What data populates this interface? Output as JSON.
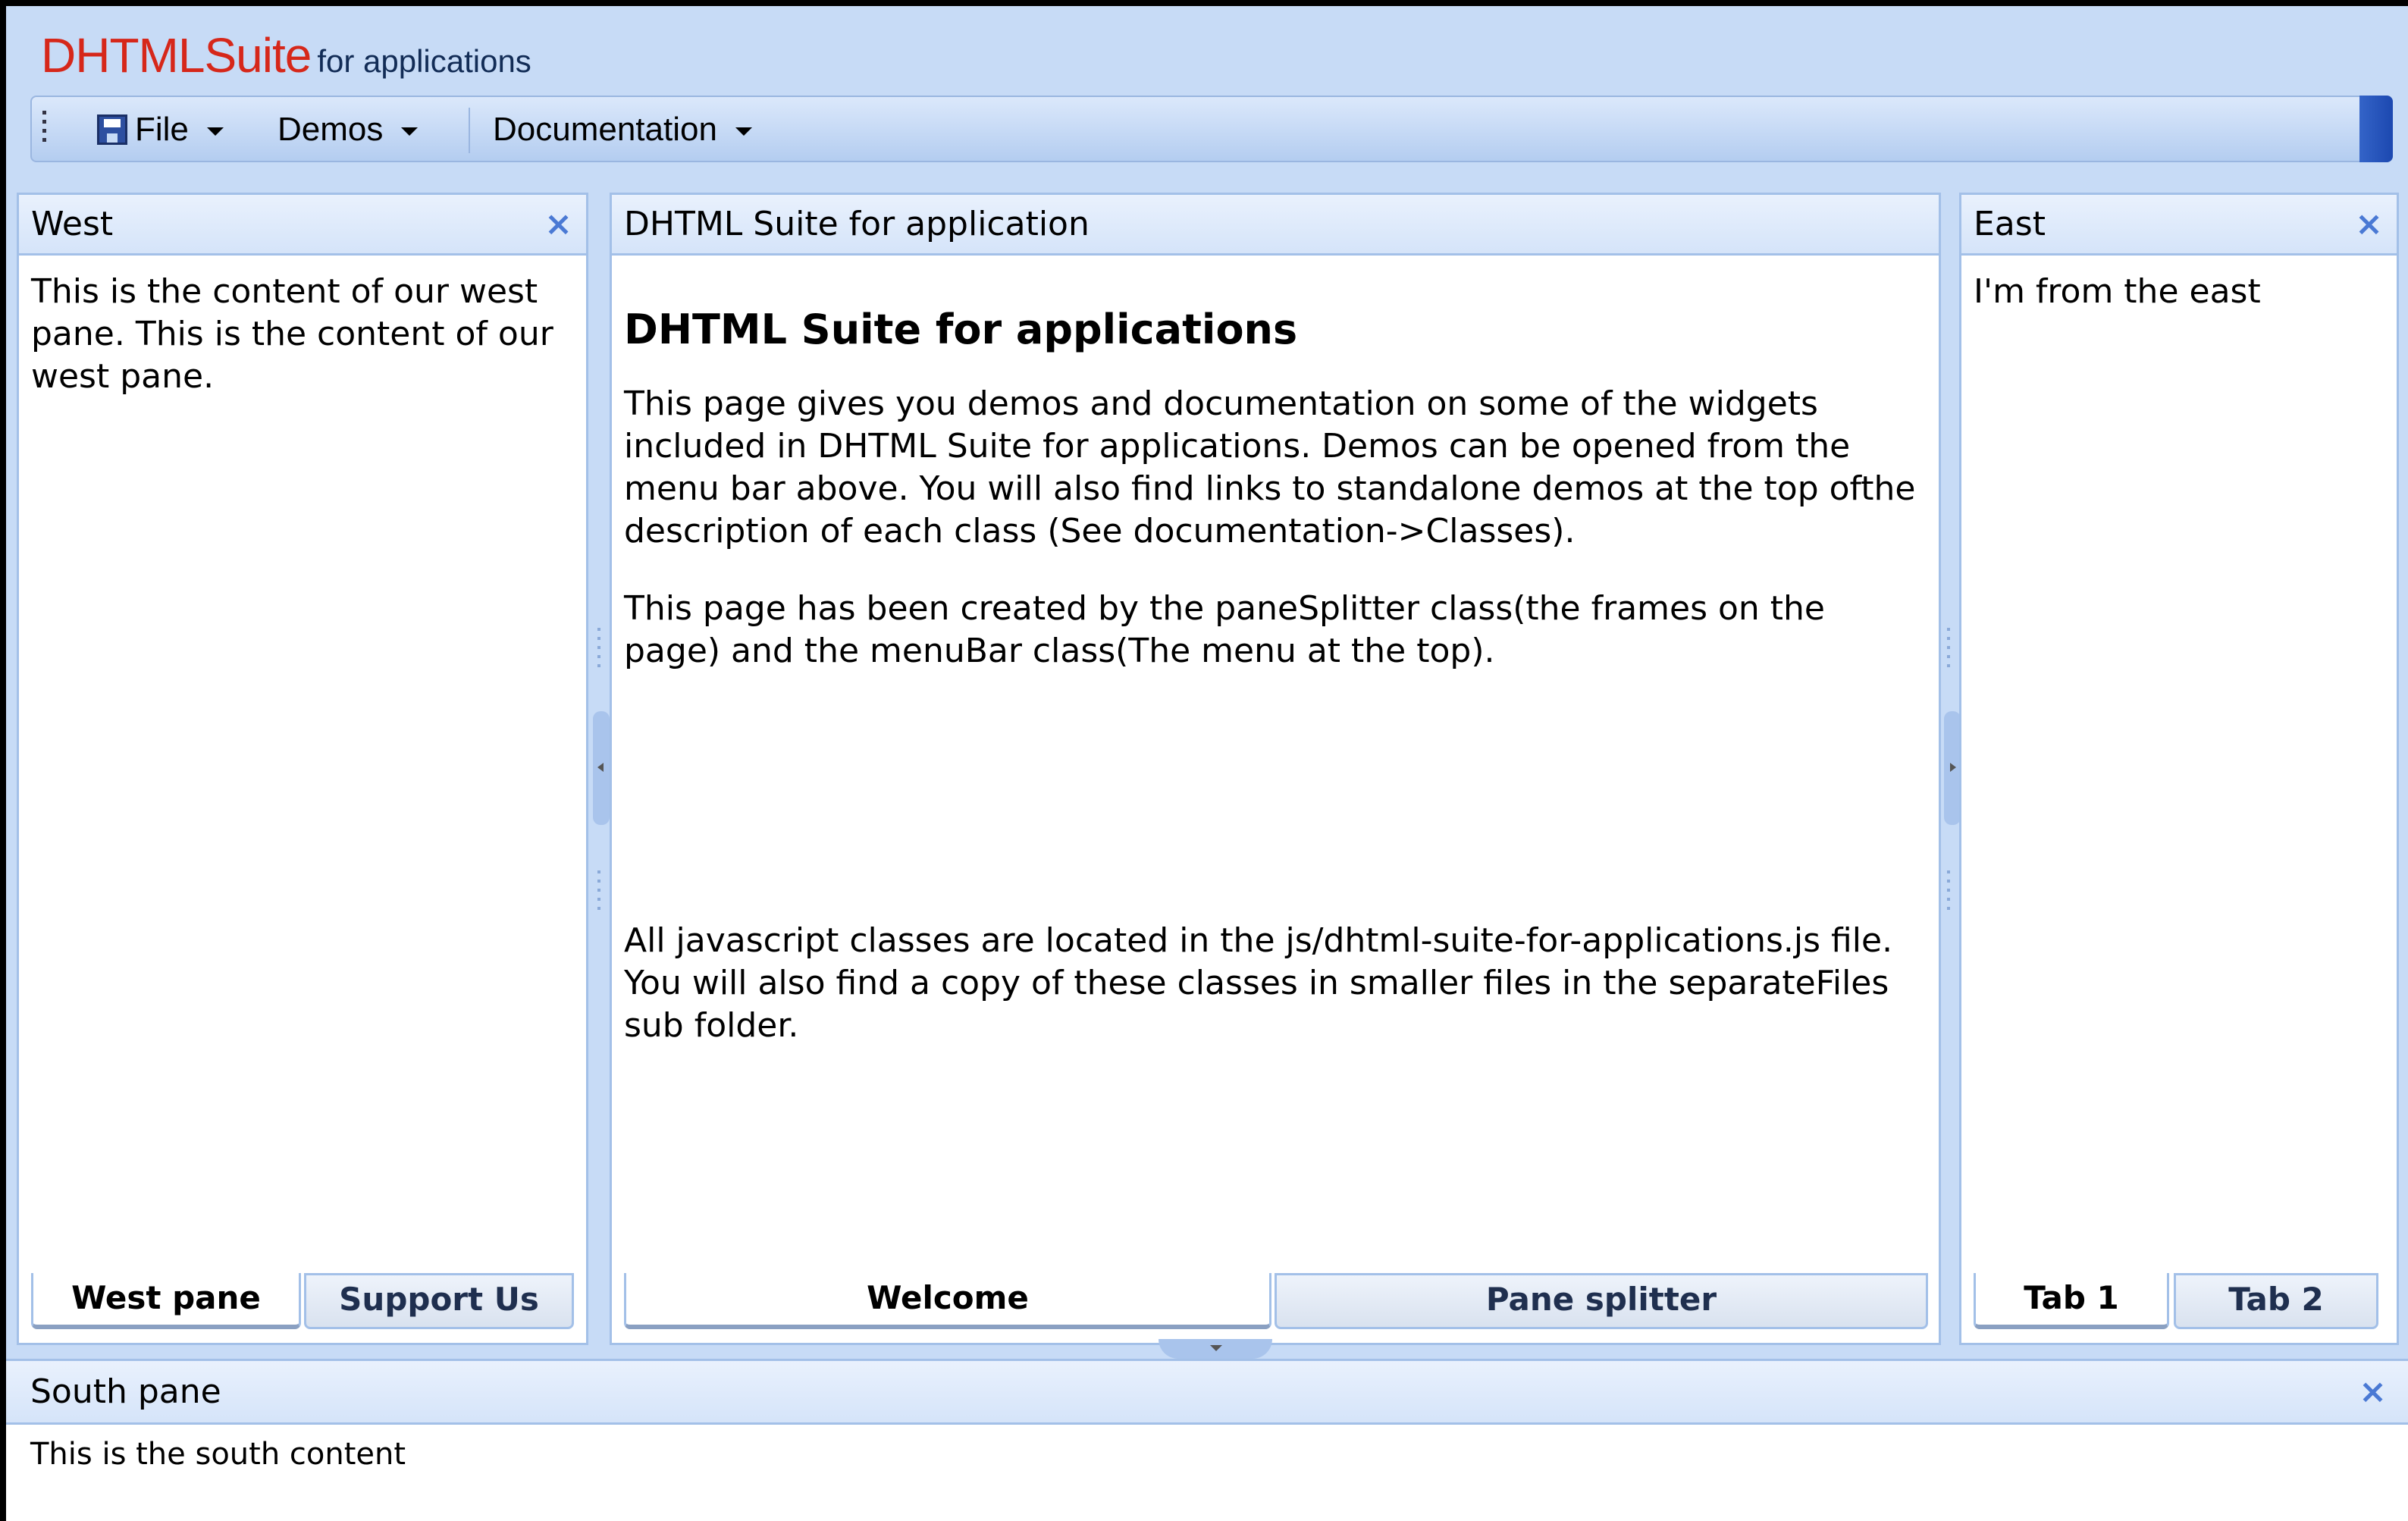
{
  "header": {
    "brand_main": "DHTMLSuite",
    "brand_sub": "for applications"
  },
  "menubar": {
    "items": [
      {
        "label": "File",
        "icon": "floppy-disk-icon"
      },
      {
        "label": "Demos"
      },
      {
        "label": "Documentation"
      }
    ]
  },
  "west": {
    "title": "West",
    "close": "×",
    "content": "This is the content of our west pane. This is the content of our west pane.",
    "tabs": [
      "West pane",
      "Support Us"
    ],
    "active_tab": "West pane"
  },
  "center": {
    "title": "DHTML Suite for application",
    "heading": "DHTML Suite for applications",
    "paragraphs": [
      "This page gives you demos and documentation on some of the widgets included in DHTML Suite for applications. Demos can be opened from the menu bar above. You will also find links to standalone demos at the top ofthe description of each class (See documentation->Classes).",
      "This page has been created by the paneSplitter class(the frames on the page) and the menuBar class(The menu at the top).",
      "All javascript classes are located in the js/dhtml-suite-for-applications.js file. You will also find a copy of these classes in smaller files in the separateFiles sub folder."
    ],
    "tabs": [
      "Welcome",
      "Pane splitter"
    ],
    "active_tab": "Welcome"
  },
  "east": {
    "title": "East",
    "close": "×",
    "content": "I'm from the east",
    "tabs": [
      "Tab 1",
      "Tab 2"
    ],
    "active_tab": "Tab 1"
  },
  "south": {
    "title": "South pane",
    "close": "×",
    "content": "This is the south content"
  },
  "colors": {
    "brand_red": "#d6271a",
    "frame_blue": "#c7dbf6",
    "close_blue": "#4a79d4"
  }
}
